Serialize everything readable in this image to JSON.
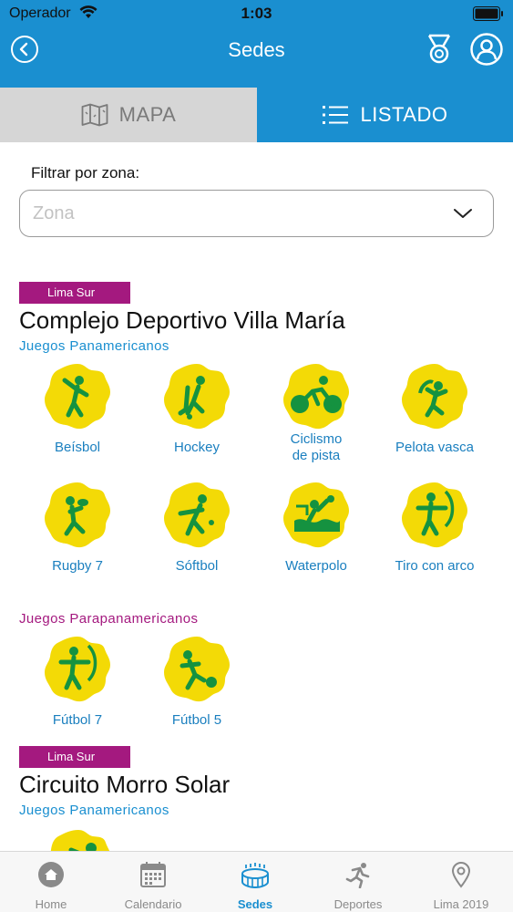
{
  "status": {
    "carrier": "Operador",
    "time": "1:03"
  },
  "header": {
    "title": "Sedes"
  },
  "tabs": {
    "map": "MAPA",
    "list": "LISTADO"
  },
  "filter": {
    "label": "Filtrar por zona:",
    "placeholder": "Zona"
  },
  "venues": [
    {
      "zone": "Lima Sur",
      "name": "Complejo Deportivo Villa María",
      "pan_label": "Juegos Panamericanos",
      "pan_sports": [
        "Beísbol",
        "Hockey",
        "Ciclismo\nde pista",
        "Pelota vasca",
        "Rugby 7",
        "Sóftbol",
        "Waterpolo",
        "Tiro con arco"
      ],
      "para_label": "Juegos Parapanamericanos",
      "para_sports": [
        "Fútbol 7",
        "Fútbol 5"
      ]
    },
    {
      "zone": "Lima Sur",
      "name": "Circuito Morro Solar",
      "pan_label": "Juegos Panamericanos"
    }
  ],
  "nav": [
    "Home",
    "Calendario",
    "Sedes",
    "Deportes",
    "Lima 2019"
  ],
  "colors": {
    "brand_blue": "#1a8fd0",
    "zone_badge": "#a4197f",
    "icon_yellow": "#f3da06",
    "icon_green": "#159240"
  }
}
